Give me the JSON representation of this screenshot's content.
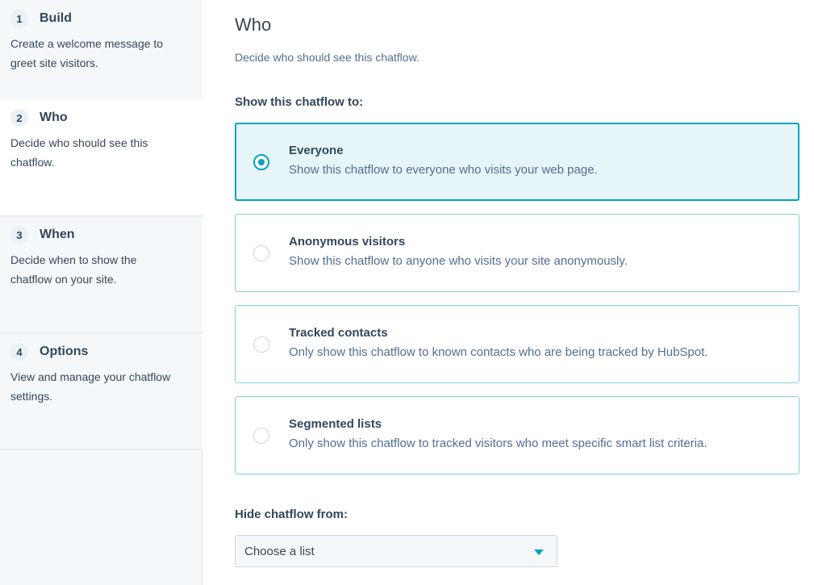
{
  "sidebar": {
    "steps": [
      {
        "number": "1",
        "title": "Build",
        "description": "Create a welcome message to greet site visitors."
      },
      {
        "number": "2",
        "title": "Who",
        "description": "Decide who should see this chatflow."
      },
      {
        "number": "3",
        "title": "When",
        "description": "Decide when to show the chatflow on your site."
      },
      {
        "number": "4",
        "title": "Options",
        "description": "View and manage your chatflow settings."
      }
    ],
    "active_step": 2
  },
  "main": {
    "title": "Who",
    "subtitle": "Decide who should see this chatflow.",
    "show_label": "Show this chatflow to:",
    "options": [
      {
        "title": "Everyone",
        "description": "Show this chatflow to everyone who visits your web page.",
        "selected": true
      },
      {
        "title": "Anonymous visitors",
        "description": "Show this chatflow to anyone who visits your site anonymously.",
        "selected": false
      },
      {
        "title": "Tracked contacts",
        "description": "Only show this chatflow to known contacts who are being tracked by HubSpot.",
        "selected": false
      },
      {
        "title": "Segmented lists",
        "description": "Only show this chatflow to tracked visitors who meet specific smart list criteria.",
        "selected": false
      }
    ],
    "hide_label": "Hide chatflow from:",
    "hide_select": {
      "value": "Choose a list"
    }
  },
  "colors": {
    "accent": "#00a4bd",
    "selected_bg": "#e5f5f8",
    "text": "#33475b",
    "sidebar_bg": "#f5f8fa"
  }
}
